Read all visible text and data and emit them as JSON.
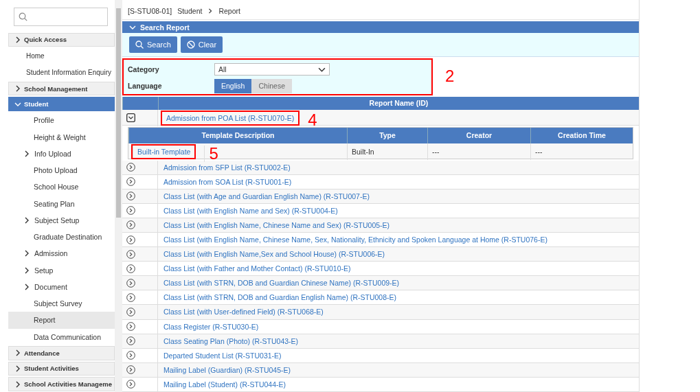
{
  "sidebar": {
    "items": [
      {
        "kind": "section",
        "label": "Quick Access",
        "expanded": false
      },
      {
        "kind": "link",
        "label": "Home",
        "selected": false
      },
      {
        "kind": "link",
        "label": "Student Information Enquiry",
        "selected": false
      },
      {
        "kind": "section",
        "label": "School Management",
        "expanded": false
      },
      {
        "kind": "section",
        "label": "Student",
        "expanded": true,
        "children": [
          {
            "label": "Profile",
            "expandable": false,
            "selected": false
          },
          {
            "label": "Height & Weight",
            "expandable": false,
            "selected": false
          },
          {
            "label": "Info Upload",
            "expandable": true,
            "selected": false
          },
          {
            "label": "Photo Upload",
            "expandable": false,
            "selected": false
          },
          {
            "label": "School House",
            "expandable": false,
            "selected": false
          },
          {
            "label": "Seating Plan",
            "expandable": false,
            "selected": false
          },
          {
            "label": "Subject Setup",
            "expandable": true,
            "selected": false
          },
          {
            "label": "Graduate Destination",
            "expandable": false,
            "selected": false
          },
          {
            "label": "Admission",
            "expandable": true,
            "selected": false
          },
          {
            "label": "Setup",
            "expandable": true,
            "selected": false
          },
          {
            "label": "Document",
            "expandable": true,
            "selected": false
          },
          {
            "label": "Subject Survey",
            "expandable": false,
            "selected": false
          },
          {
            "label": "Report",
            "expandable": false,
            "selected": true
          },
          {
            "label": "Data Communication",
            "expandable": false,
            "selected": false
          }
        ]
      },
      {
        "kind": "section",
        "label": "Attendance",
        "expanded": false
      },
      {
        "kind": "section",
        "label": "Student Activities",
        "expanded": false
      },
      {
        "kind": "section",
        "label": "School Activities Manageme",
        "expanded": false
      }
    ]
  },
  "breadcrumb": {
    "code": "[S-STU08-01]",
    "path": [
      "Student",
      "Report"
    ]
  },
  "search_panel": {
    "title": "Search Report",
    "expanded": true,
    "buttons": [
      {
        "kind": "search",
        "label": "Search"
      },
      {
        "kind": "clear",
        "label": "Clear"
      }
    ],
    "category": {
      "label": "Category",
      "value": "All"
    },
    "language": {
      "label": "Language",
      "options": [
        {
          "label": "English",
          "selected": true
        },
        {
          "label": "Chinese",
          "selected": false
        }
      ]
    },
    "callout": "2"
  },
  "table": {
    "columns": [
      "Report Name (ID)"
    ],
    "template_columns": [
      "Template Description",
      "Type",
      "Creator",
      "Creation Time"
    ],
    "rows": [
      {
        "name": "Admission from POA List (R-STU070-E)",
        "expanded": true,
        "callout": "4",
        "templates": [
          {
            "description": "Built-in Template",
            "type": "Built-In",
            "creator": "---",
            "creation_time": "---",
            "callout": "5"
          }
        ]
      },
      {
        "name": "Admission from SFP List (R-STU002-E)",
        "expanded": false
      },
      {
        "name": "Admission from SOA List (R-STU001-E)",
        "expanded": false
      },
      {
        "name": "Class List (with Age and Guardian English Name) (R-STU007-E)",
        "expanded": false
      },
      {
        "name": "Class List (with English Name and Sex) (R-STU004-E)",
        "expanded": false
      },
      {
        "name": "Class List (with English Name, Chinese Name and Sex) (R-STU005-E)",
        "expanded": false
      },
      {
        "name": "Class List (with English Name, Chinese Name, Sex, Nationality, Ethnicity and Spoken Language at Home (R-STU076-E)",
        "expanded": false
      },
      {
        "name": "Class List (with English Name,Sex and School House) (R-STU006-E)",
        "expanded": false
      },
      {
        "name": "Class List (with Father and Mother Contact) (R-STU010-E)",
        "expanded": false
      },
      {
        "name": "Class List (with STRN, DOB and Guardian Chinese Name) (R-STU009-E)",
        "expanded": false
      },
      {
        "name": "Class List (with STRN, DOB and Guardian English Name) (R-STU008-E)",
        "expanded": false
      },
      {
        "name": "Class List (with User-defined Field) (R-STU068-E)",
        "expanded": false
      },
      {
        "name": "Class Register (R-STU030-E)",
        "expanded": false
      },
      {
        "name": "Class Seating Plan (Photo) (R-STU043-E)",
        "expanded": false
      },
      {
        "name": "Departed Student List (R-STU031-E)",
        "expanded": false
      },
      {
        "name": "Mailing Label (Guardian) (R-STU045-E)",
        "expanded": false
      },
      {
        "name": "Mailing Label (Student) (R-STU044-E)",
        "expanded": false
      }
    ]
  }
}
